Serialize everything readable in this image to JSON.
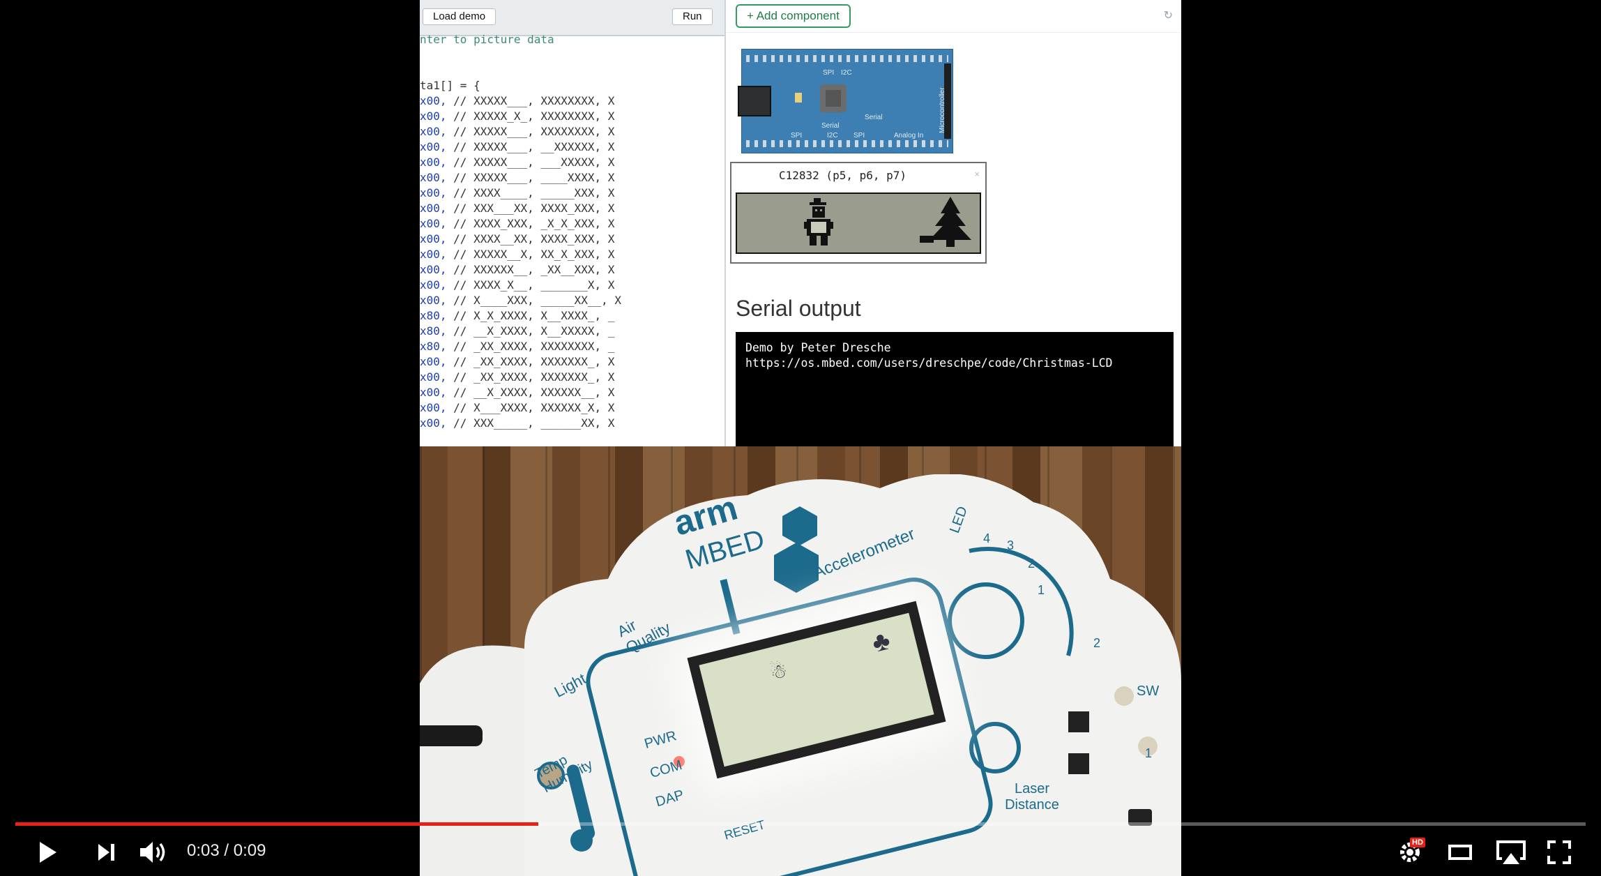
{
  "editor": {
    "load_demo_label": "Load demo",
    "run_label": "Run",
    "lines": [
      {
        "hex": "",
        "comment": "nter to picture data"
      },
      {
        "hex": "",
        "comment": ""
      },
      {
        "hex": "",
        "comment": ""
      },
      {
        "hex": "",
        "comment": "ta1[] = {"
      },
      {
        "hex": "x00,",
        "comment": " // XXXXX___, XXXXXXXX, X"
      },
      {
        "hex": "x00,",
        "comment": " // XXXXX_X_, XXXXXXXX, X"
      },
      {
        "hex": "x00,",
        "comment": " // XXXXX___, XXXXXXXX, X"
      },
      {
        "hex": "x00,",
        "comment": " // XXXXX___, __XXXXXX, X"
      },
      {
        "hex": "x00,",
        "comment": " // XXXXX___, ___XXXXX, X"
      },
      {
        "hex": "x00,",
        "comment": " // XXXXX___, ____XXXX, X"
      },
      {
        "hex": "x00,",
        "comment": " // XXXX____, _____XXX, X"
      },
      {
        "hex": "x00,",
        "comment": " // XXX___XX, XXXX_XXX, X"
      },
      {
        "hex": "x00,",
        "comment": " // XXXX_XXX, _X_X_XXX, X"
      },
      {
        "hex": "x00,",
        "comment": " // XXXX__XX, XXXX_XXX, X"
      },
      {
        "hex": "x00,",
        "comment": " // XXXXX__X, XX_X_XXX, X"
      },
      {
        "hex": "x00,",
        "comment": " // XXXXXX__, _XX__XXX, X"
      },
      {
        "hex": "x00,",
        "comment": " // XXXX_X__, _______X, X"
      },
      {
        "hex": "x00,",
        "comment": " // X____XXX, _____XX__, X"
      },
      {
        "hex": "x80,",
        "comment": " // X_X_XXXX, X__XXXX_, _"
      },
      {
        "hex": "x80,",
        "comment": " // __X_XXXX, X__XXXXX, _"
      },
      {
        "hex": "x80,",
        "comment": " // _XX_XXXX, XXXXXXXX, _"
      },
      {
        "hex": "x00,",
        "comment": " // _XX_XXXX, XXXXXXX_, X"
      },
      {
        "hex": "x00,",
        "comment": " // _XX_XXXX, XXXXXXX_, X"
      },
      {
        "hex": "x00,",
        "comment": " // __X_XXXX, XXXXXX__, X"
      },
      {
        "hex": "x00,",
        "comment": " // X___XXXX, XXXXXX_X, X"
      },
      {
        "hex": "x00,",
        "comment": " // XXX_____, ______XX, X"
      }
    ]
  },
  "simulator": {
    "add_component_label": "+ Add component",
    "refresh_icon": "↻",
    "board_labels": [
      "SPI",
      "Serial",
      "I2C",
      "SPI",
      "Serial",
      "Analog In",
      "I2C",
      "SPI",
      "Microcontroller"
    ],
    "lcd_title": "C12832 (p5, p6, p7)",
    "lcd_close": "×",
    "serial_heading": "Serial output",
    "serial_lines": [
      "Demo by Peter Dresche",
      "https://os.mbed.com/users/dreschpe/code/Christmas-LCD"
    ]
  },
  "photo": {
    "brand_top": "arm",
    "brand_bottom": "MBED",
    "labels": {
      "accelerometer": "Accelerometer",
      "air_quality": "Air Quality",
      "light": "Light",
      "temp_humidity": "Temp Humidity",
      "pwr": "PWR",
      "com": "COM",
      "dap": "DAP",
      "reset": "RESET",
      "laser_distance": "Laser Distance",
      "led": "LED",
      "sw": "SW",
      "sw_num_top": "2",
      "sw_num_bottom": "1",
      "led_scale": [
        "4",
        "3",
        "2",
        "1"
      ]
    }
  },
  "player": {
    "current_time": "0:03",
    "duration": "0:09",
    "time_separator": " / ",
    "progress_fraction": 0.333,
    "hd_badge": "HD",
    "accent_color": "#e62117"
  }
}
